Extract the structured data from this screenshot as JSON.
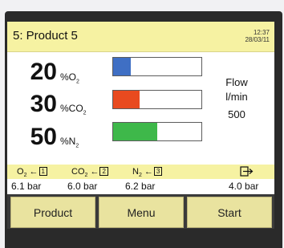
{
  "header": {
    "title": "5: Product 5",
    "time": "12:37",
    "date": "28/03/11"
  },
  "gases": [
    {
      "value": "20",
      "unit_prefix": "%O",
      "unit_sub": "2",
      "fill_fraction": 0.2,
      "color": "#3f6fc4"
    },
    {
      "value": "30",
      "unit_prefix": "%CO",
      "unit_sub": "2",
      "fill_fraction": 0.3,
      "color": "#e84a1f"
    },
    {
      "value": "50",
      "unit_prefix": "%N",
      "unit_sub": "2",
      "fill_fraction": 0.5,
      "color": "#3eb84a"
    }
  ],
  "flow": {
    "label": "Flow",
    "unit": "l/min",
    "value": "500"
  },
  "ports": [
    {
      "name_prefix": "O",
      "name_sub": "2",
      "port": "1",
      "pressure": "6.1 bar"
    },
    {
      "name_prefix": "CO",
      "name_sub": "2",
      "port": "2",
      "pressure": "6.0 bar"
    },
    {
      "name_prefix": "N",
      "name_sub": "2",
      "port": "3",
      "pressure": "6.2 bar"
    },
    {
      "name_prefix": "",
      "name_sub": "",
      "port": "",
      "pressure": "4.0 bar"
    }
  ],
  "buttons": {
    "product": "Product",
    "menu": "Menu",
    "start": "Start"
  },
  "colors": {
    "header_bg": "#f6f2a2",
    "button_bg": "#e9e39f",
    "frame": "#2a2a2a"
  }
}
